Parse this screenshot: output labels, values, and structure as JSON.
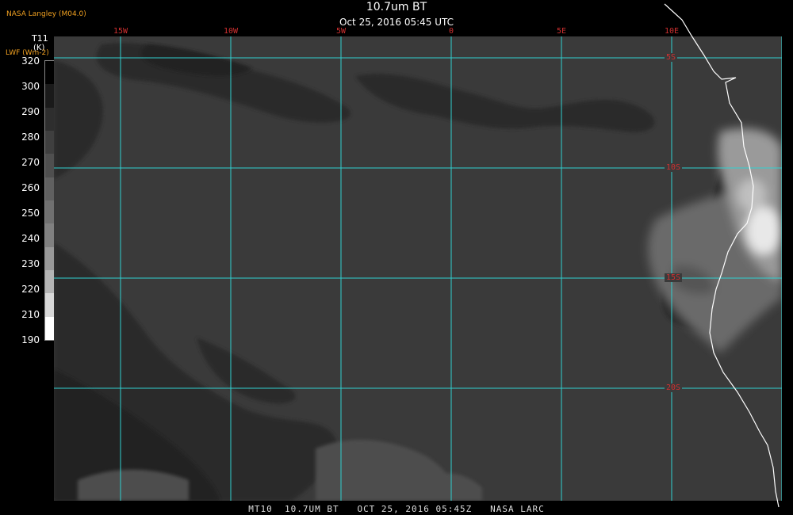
{
  "header": {
    "credit": "NASA Langley (M04.0)",
    "title": "10.7um BT",
    "subtitle": "Oct 25, 2016 05:45 UTC"
  },
  "legend": {
    "variable": "T11",
    "unit": "(K)",
    "alt_label": "LWF (Wm-2)",
    "ticks": [
      "320",
      "300",
      "290",
      "280",
      "270",
      "260",
      "250",
      "240",
      "230",
      "220",
      "210",
      "190"
    ],
    "shades": [
      "#000000",
      "#1a1a1a",
      "#2e2e2e",
      "#3f3f3f",
      "#4f4f4f",
      "#606060",
      "#707070",
      "#808080",
      "#989898",
      "#b4b4b4",
      "#d8d8d8",
      "#ffffff"
    ]
  },
  "grid": {
    "color": "#30d0d0",
    "lon_labels": [
      "15W",
      "10W",
      "5W",
      "0",
      "5E",
      "10E"
    ],
    "lat_labels": [
      "5S",
      "10S",
      "15S",
      "20S"
    ]
  },
  "footer": {
    "text": "MT10  10.7UM BT   OCT 25, 2016 05:45Z   NASA LARC"
  }
}
